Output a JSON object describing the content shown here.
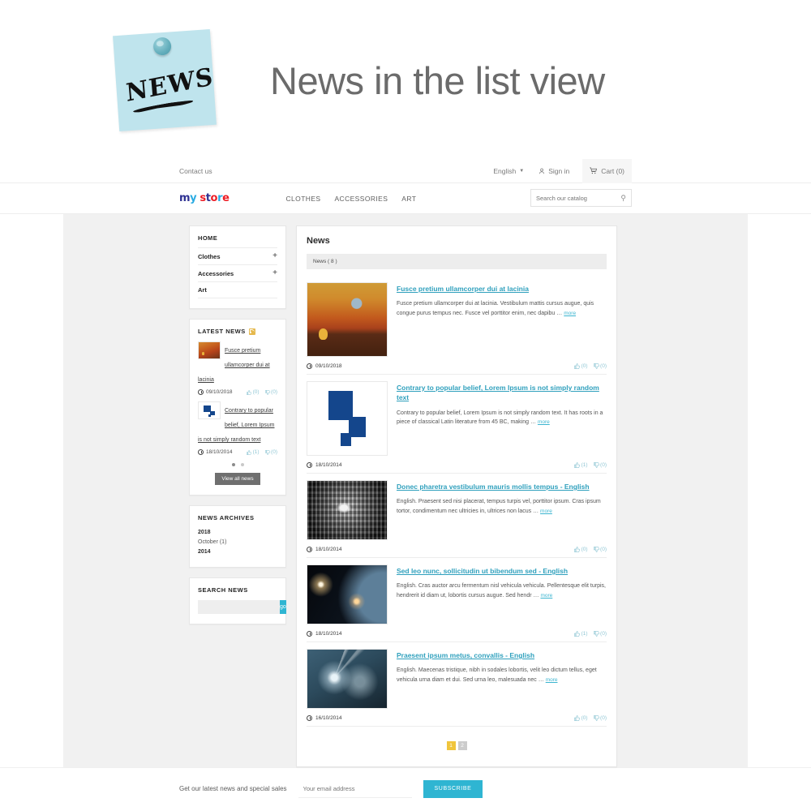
{
  "banner": {
    "sticky_word": "NEWS",
    "title": "News in the list view"
  },
  "topbar": {
    "contact": "Contact us",
    "language": "English",
    "signin": "Sign in",
    "cart": "Cart (0)"
  },
  "logo": {
    "l1": "m",
    "l2": "y",
    "l3": "s",
    "l4": "t",
    "l5": "o",
    "l6": "r",
    "l7": "e"
  },
  "mainmenu": [
    {
      "label": "CLOTHES"
    },
    {
      "label": "ACCESSORIES"
    },
    {
      "label": "ART"
    }
  ],
  "search": {
    "placeholder": "Search our catalog",
    "icon": "search-icon"
  },
  "categories": {
    "home": "HOME",
    "items": [
      {
        "label": "Clothes",
        "expander": "+"
      },
      {
        "label": "Accessories",
        "expander": "+"
      },
      {
        "label": "Art",
        "expander": ""
      }
    ]
  },
  "latest_news": {
    "title": "LATEST NEWS",
    "icon": "rss-icon",
    "items": [
      {
        "title": "Fusce pretium ullamcorper dui at lacinia",
        "date": "09/10/2018",
        "likes": "(0)",
        "dislikes": "(0)"
      },
      {
        "title": "Contrary to popular belief, Lorem Ipsum is not simply random text",
        "date": "18/10/2014",
        "likes": "(1)",
        "dislikes": "(0)"
      }
    ],
    "view_all": "View all news"
  },
  "archives": {
    "title": "NEWS ARCHIVES",
    "years": [
      {
        "year": "2018",
        "months": [
          "October (1)"
        ]
      },
      {
        "year": "2014",
        "months": []
      }
    ]
  },
  "search_news": {
    "title": "SEARCH NEWS",
    "value": "",
    "placeholder": "",
    "button": "go"
  },
  "news": {
    "heading": "News",
    "count_label": "News ( 8 )",
    "articles": [
      {
        "title": "Fusce pretium ullamcorper dui at lacinia",
        "excerpt": "Fusce pretium ullamcorper dui at lacinia. Vestibulum mattis cursus augue, quis congue purus tempus nec. Fusce vel porttitor enim, nec dapibu",
        "more": "more",
        "date": "09/10/2018",
        "likes": "(0)",
        "dislikes": "(0)"
      },
      {
        "title": "Contrary to popular belief, Lorem Ipsum is not simply random text",
        "excerpt": "Contrary to popular belief, Lorem Ipsum is not simply random text. It has roots in a piece of classical Latin literature from 45 BC, making",
        "more": "more",
        "date": "18/10/2014",
        "likes": "(1)",
        "dislikes": "(0)"
      },
      {
        "title": "Donec pharetra vestibulum mauris mollis tempus - English",
        "excerpt": "English. Praesent sed nisi placerat, tempus turpis vel, porttitor ipsum. Cras ipsum tortor, condimentum nec ultricies in, ultrices non lacus",
        "more": "more",
        "date": "18/10/2014",
        "likes": "(0)",
        "dislikes": "(0)"
      },
      {
        "title": "Sed leo nunc, sollicitudin ut bibendum sed - English",
        "excerpt": "English. Cras auctor arcu fermentum nisl vehicula vehicula. Pellentesque elit turpis, hendrerit id diam ut, lobortis cursus augue. Sed hendr",
        "more": "more",
        "date": "18/10/2014",
        "likes": "(1)",
        "dislikes": "(0)"
      },
      {
        "title": "Praesent ipsum metus, convallis - English",
        "excerpt": "English. Maecenas tristique, nibh in sodales lobortis, velit leo dictum tellus, eget vehicula urna diam et dui. Sed urna leo, malesuada nec",
        "more": "more",
        "date": "16/10/2014",
        "likes": "(0)",
        "dislikes": "(0)"
      }
    ],
    "pagination": [
      {
        "label": "1",
        "current": true
      },
      {
        "label": "2",
        "current": false
      }
    ]
  },
  "newsletter": {
    "label": "Get our latest news and special sales",
    "placeholder": "Your email address",
    "value": "",
    "button": "SUBSCRIBE"
  },
  "colors": {
    "accent": "#2fb5d2",
    "link": "#2fa0bd",
    "page_bg": "#f1f1f1",
    "pagination_current": "#f0c53c",
    "sticky_note": "#bfe4ed"
  }
}
